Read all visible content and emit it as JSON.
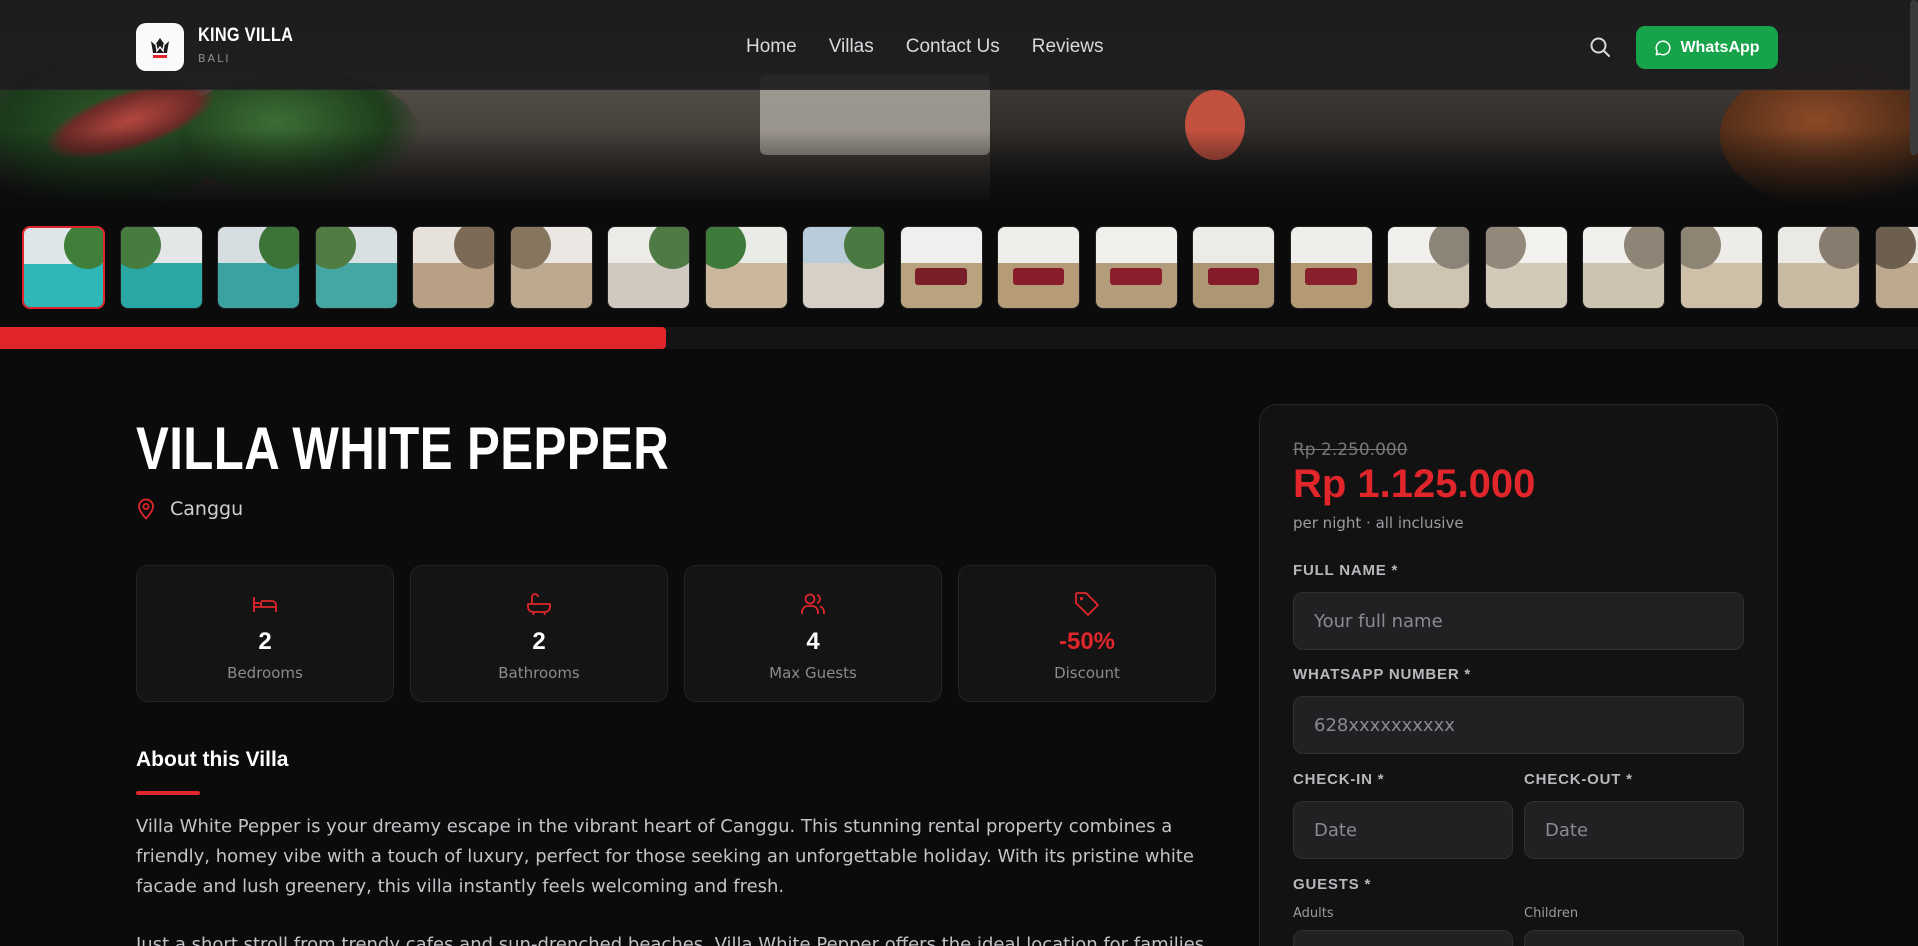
{
  "brand": {
    "name": "KING VILLA",
    "sub": "BALI"
  },
  "nav": {
    "links": [
      "Home",
      "Villas",
      "Contact Us",
      "Reviews"
    ],
    "whatsapp_label": "WhatsApp"
  },
  "gallery": {
    "thumbnail_count": 20,
    "active_index": 0,
    "scroll_progress": 0.347
  },
  "villa": {
    "title": "VILLA WHITE PEPPER",
    "location": "Canggu",
    "stats": [
      {
        "icon": "bed-icon",
        "value": "2",
        "label": "Bedrooms"
      },
      {
        "icon": "bath-icon",
        "value": "2",
        "label": "Bathrooms"
      },
      {
        "icon": "users-icon",
        "value": "4",
        "label": "Max Guests"
      },
      {
        "icon": "tag-icon",
        "value": "-50%",
        "label": "Discount"
      }
    ],
    "about_heading": "About this Villa",
    "about_text": "Villa White Pepper is your dreamy escape in the vibrant heart of Canggu. This stunning rental property combines a friendly, homey vibe with a touch of luxury, perfect for those seeking an unforgettable holiday. With its pristine white facade and lush greenery, this villa instantly feels welcoming and fresh.",
    "about_text_2": "Just a short stroll from trendy cafes and sun-drenched beaches, Villa White Pepper offers the ideal location for families"
  },
  "booking": {
    "old_price": "Rp 2.250.000",
    "price": "Rp 1.125.000",
    "price_note": "per night · all inclusive",
    "full_name_label": "FULL NAME *",
    "full_name_placeholder": "Your full name",
    "whatsapp_label": "WHATSAPP NUMBER *",
    "whatsapp_placeholder": "628xxxxxxxxxx",
    "checkin_label": "CHECK-IN *",
    "checkin_placeholder": "Date",
    "checkout_label": "CHECK-OUT *",
    "checkout_placeholder": "Date",
    "guests_label": "GUESTS *",
    "adults_label": "Adults",
    "children_label": "Children"
  },
  "colors": {
    "accent": "#e0262a",
    "whatsapp": "#16a34a",
    "background": "#0b0b0c"
  }
}
